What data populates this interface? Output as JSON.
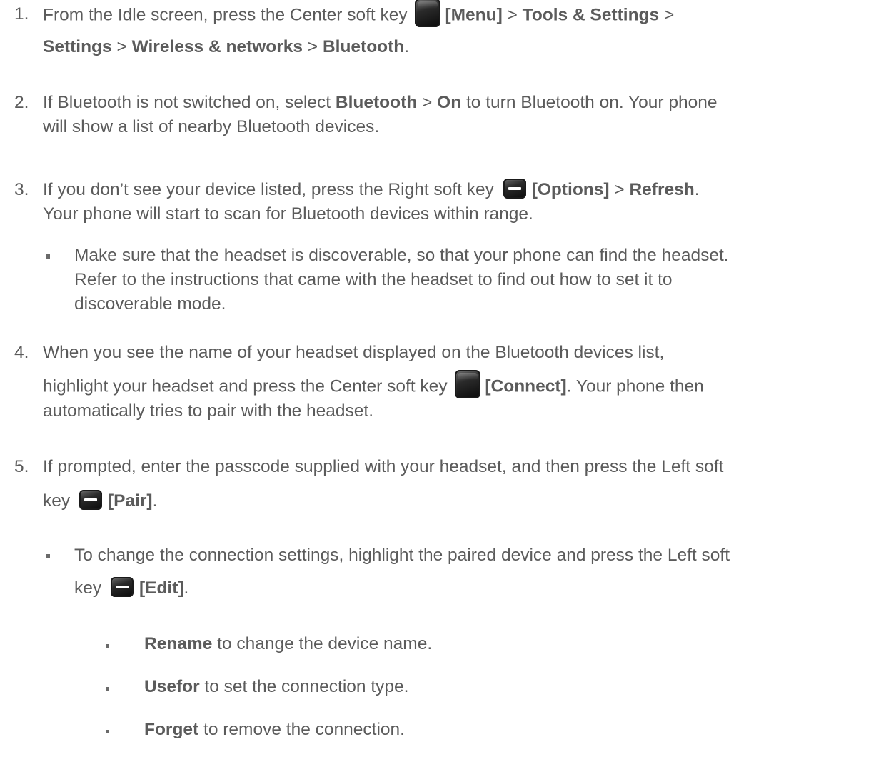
{
  "steps": [
    {
      "number": "1.",
      "line1_pre": "From the Idle screen, press the Center soft key ",
      "line1_key_label": "[Menu]",
      "line1_sep1": " > ",
      "line1_b1": "Tools & Settings",
      "line1_sep2": " >",
      "line2_b1": "Settings",
      "line2_sep1": " > ",
      "line2_b2": "Wireless & networks",
      "line2_sep2": " > ",
      "line2_b3": "Bluetooth",
      "line2_end": ".",
      "key_icon": "center-soft-key-icon"
    },
    {
      "number": "2.",
      "line1_pre": "If Bluetooth is not switched on, select ",
      "line1_b1": "Bluetooth",
      "line1_sep1": " > ",
      "line1_b2": "On",
      "line1_post": " to turn Bluetooth on. Your phone",
      "line2": "will show a list of nearby Bluetooth devices."
    },
    {
      "number": "3.",
      "line1_pre": "If you don’t see your device listed, press the Right soft key ",
      "line1_key_label": "[Options]",
      "line1_sep1": " > ",
      "line1_b1": "Refresh",
      "line1_end": ".",
      "line2": "Your phone will start to scan for Bluetooth devices within range.",
      "key_icon": "right-soft-key-icon",
      "bullet": {
        "line1": "Make sure that the headset is discoverable, so that your phone can find the headset.",
        "line2": "Refer to the instructions that came with the headset to find out how to set it to",
        "line3": "discoverable mode."
      }
    },
    {
      "number": "4.",
      "line1": "When you see the name of your headset displayed on the Bluetooth devices list,",
      "line2_pre": "highlight your headset and press the Center soft key ",
      "line2_key_label": "[Connect]",
      "line2_post": ". Your phone then",
      "line3": "automatically tries to pair with the headset.",
      "key_icon": "center-soft-key-icon"
    },
    {
      "number": "5.",
      "line1": "If prompted, enter the passcode supplied with your headset, and then press the Left soft",
      "line2_pre": "key ",
      "line2_key_label": "[Pair]",
      "line2_end": ".",
      "key_icon": "left-soft-key-icon",
      "bullet": {
        "line1": "To change the connection settings, highlight the paired device and press the Left soft",
        "line2_pre": "key ",
        "line2_key_label": "[Edit]",
        "line2_end": ".",
        "subitems": [
          {
            "bold": "Rename",
            "text": " to change the device name."
          },
          {
            "bold": "Usefor",
            "text": " to set the connection type."
          },
          {
            "bold": "Forget",
            "text": " to remove the connection."
          }
        ]
      }
    }
  ]
}
